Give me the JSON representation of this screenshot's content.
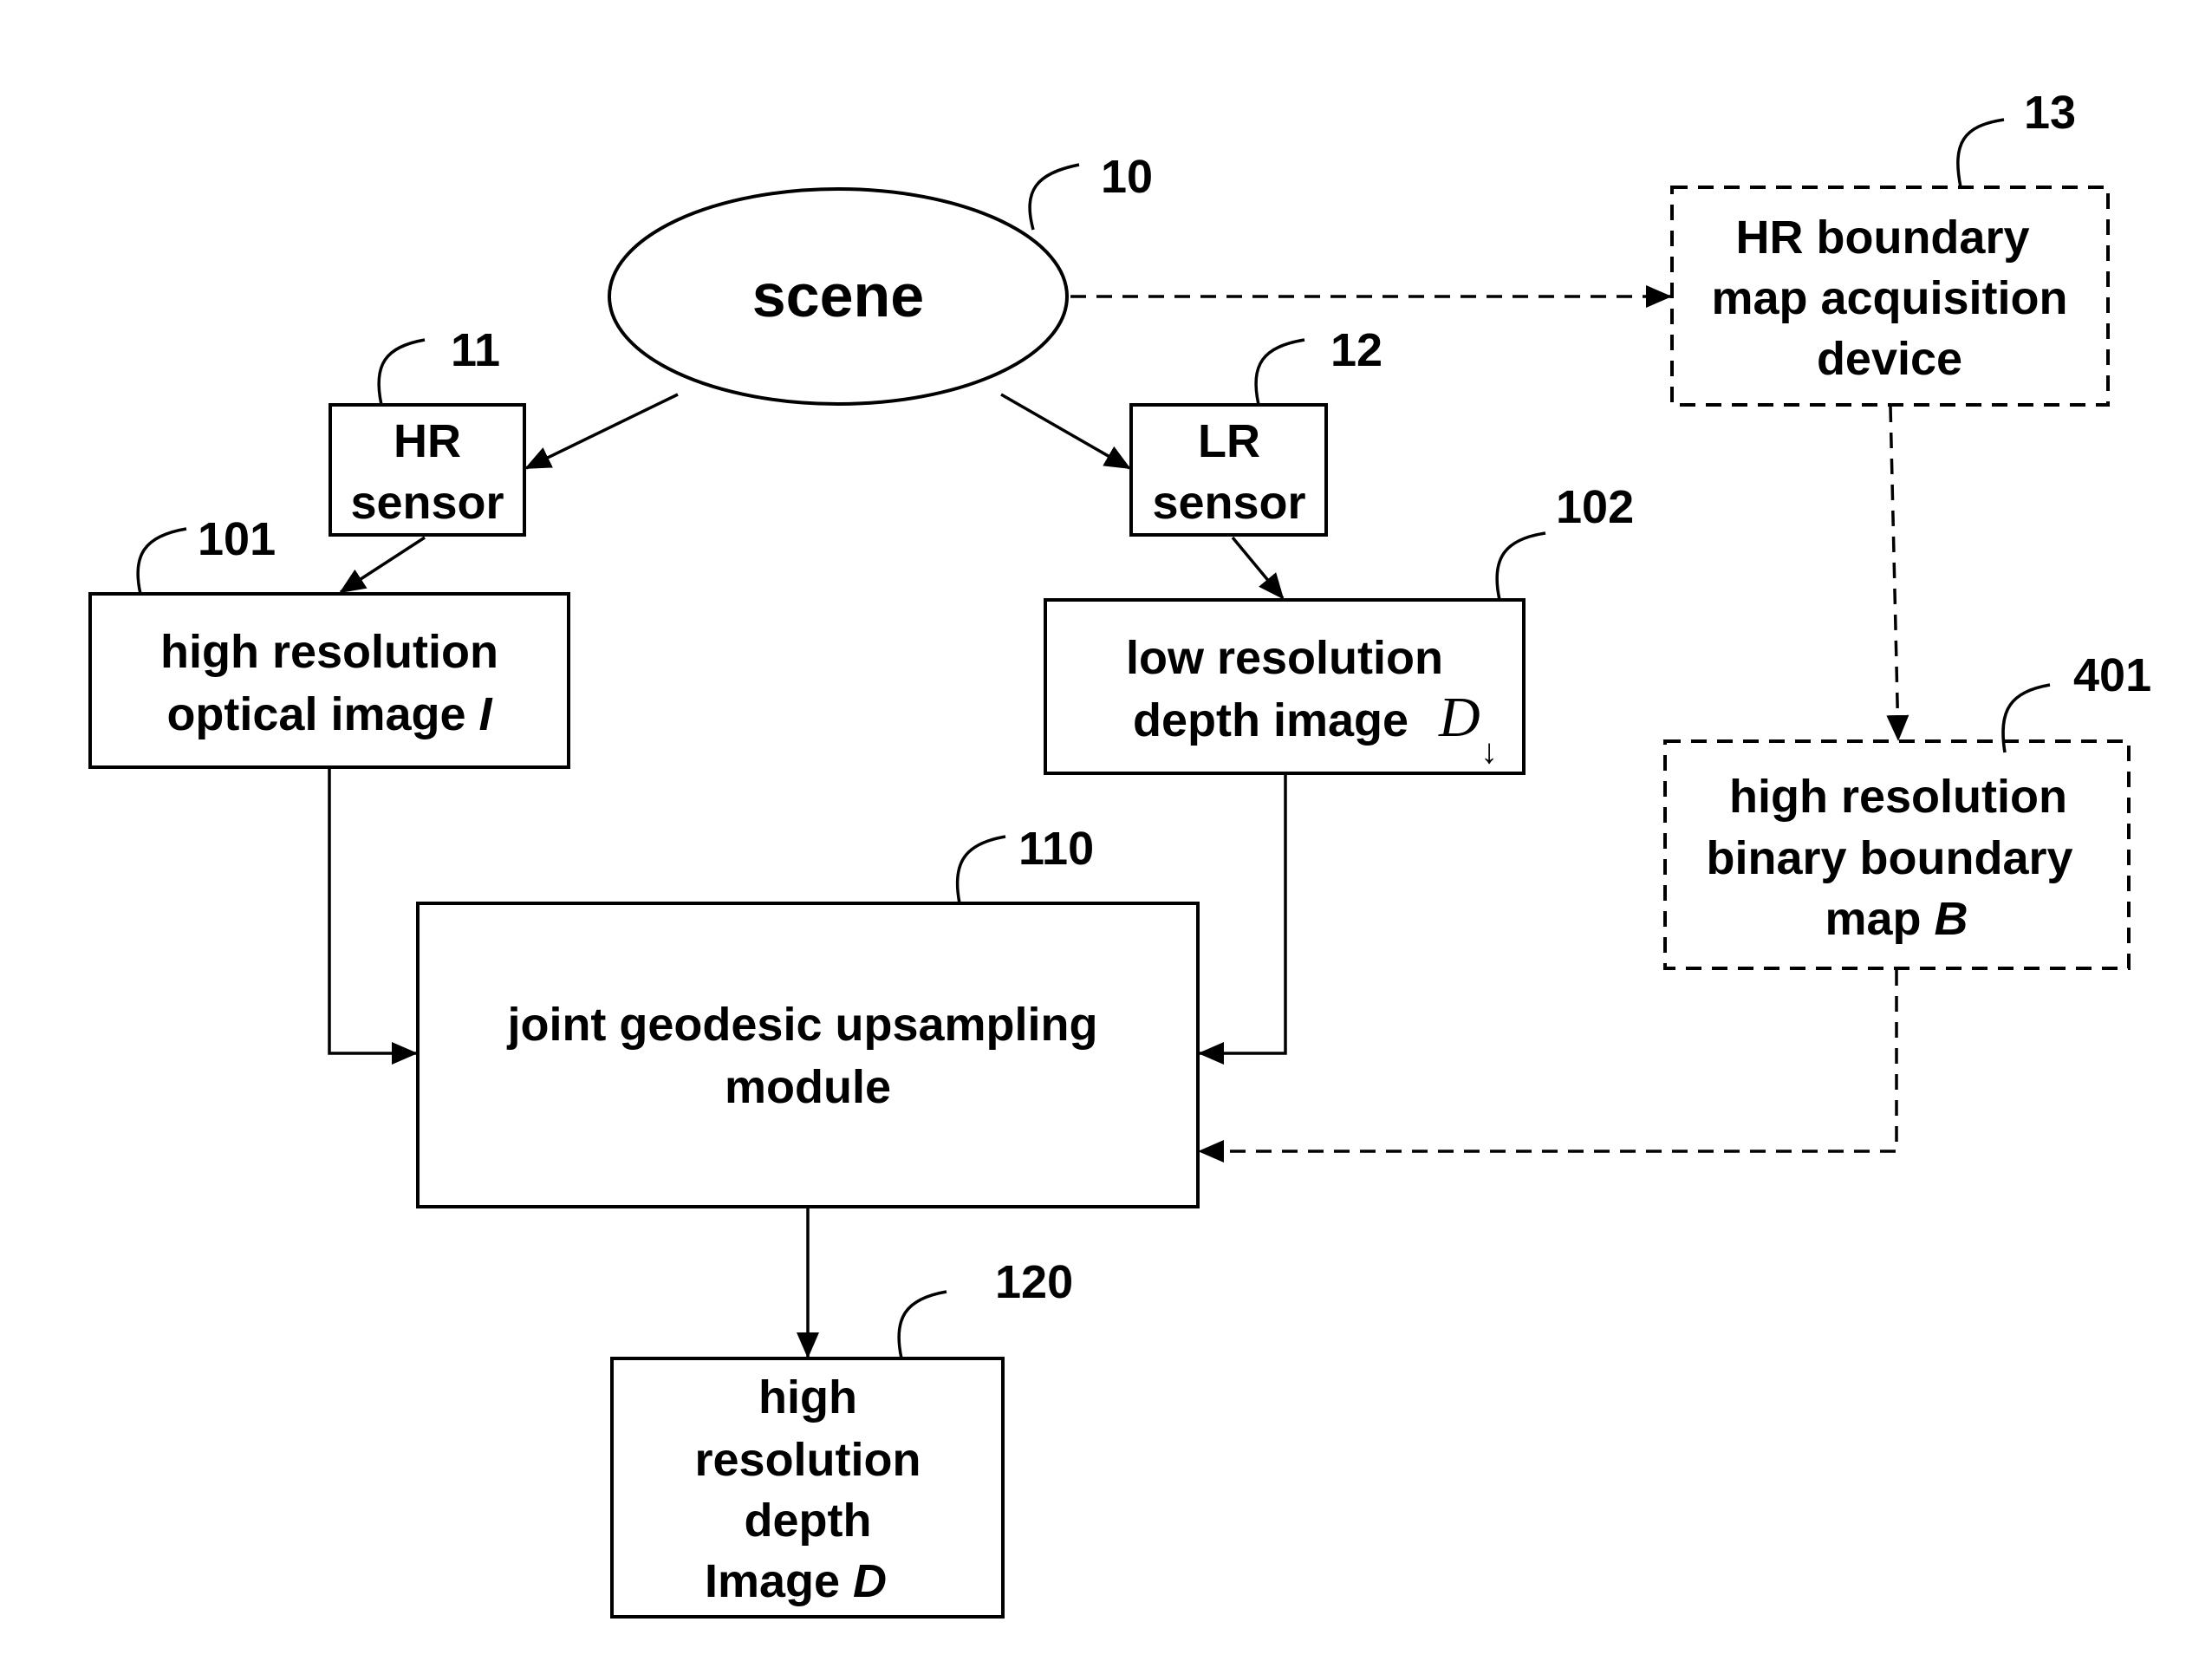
{
  "diagram": {
    "nodes": {
      "scene": {
        "ref": "10",
        "lines": [
          "scene"
        ]
      },
      "hr_sensor": {
        "ref": "11",
        "lines": [
          "HR",
          "sensor"
        ]
      },
      "lr_sensor": {
        "ref": "12",
        "lines": [
          "LR",
          "sensor"
        ]
      },
      "hr_boundary_device": {
        "ref": "13",
        "lines": [
          "HR boundary",
          "map acquisition",
          "device"
        ],
        "style": "dashed"
      },
      "hr_optical_image": {
        "ref": "101",
        "lines": [
          "high resolution",
          "optical image"
        ],
        "symbol": "I"
      },
      "lr_depth_image": {
        "ref": "102",
        "lines": [
          "low resolution",
          "depth image"
        ],
        "symbol": "D",
        "symbol_sub": "↓"
      },
      "joint_upsampling": {
        "ref": "110",
        "lines": [
          "joint geodesic upsampling",
          "module"
        ]
      },
      "hr_depth_image": {
        "ref": "120",
        "lines": [
          "high",
          "resolution",
          "depth",
          "Image"
        ],
        "symbol": "D"
      },
      "hr_binary_boundary": {
        "ref": "401",
        "lines": [
          "high resolution",
          "binary boundary",
          "map"
        ],
        "symbol": "B",
        "style": "dashed"
      }
    },
    "edges": [
      {
        "from": "scene",
        "to": "hr_sensor",
        "style": "solid"
      },
      {
        "from": "scene",
        "to": "lr_sensor",
        "style": "solid"
      },
      {
        "from": "scene",
        "to": "hr_boundary_device",
        "style": "dashed"
      },
      {
        "from": "hr_sensor",
        "to": "hr_optical_image",
        "style": "solid"
      },
      {
        "from": "lr_sensor",
        "to": "lr_depth_image",
        "style": "solid"
      },
      {
        "from": "hr_boundary_device",
        "to": "hr_binary_boundary",
        "style": "dashed"
      },
      {
        "from": "hr_optical_image",
        "to": "joint_upsampling",
        "style": "solid"
      },
      {
        "from": "lr_depth_image",
        "to": "joint_upsampling",
        "style": "solid"
      },
      {
        "from": "hr_binary_boundary",
        "to": "joint_upsampling",
        "style": "dashed"
      },
      {
        "from": "joint_upsampling",
        "to": "hr_depth_image",
        "style": "solid"
      }
    ]
  }
}
